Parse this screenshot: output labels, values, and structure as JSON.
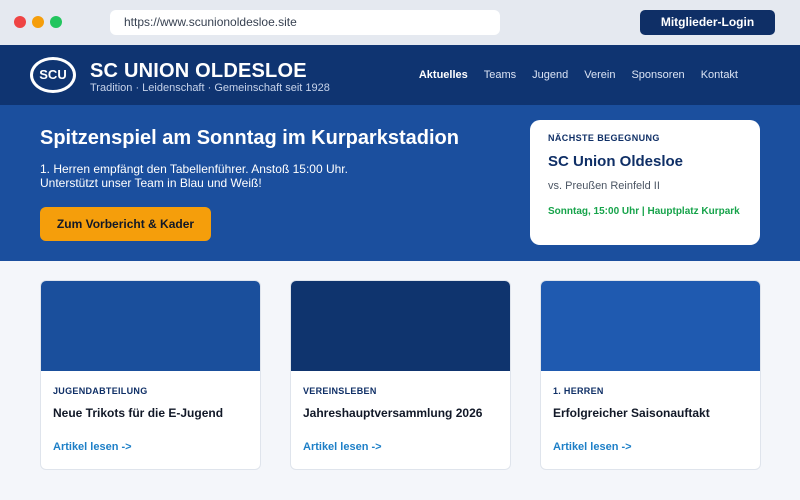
{
  "browser": {
    "url": "https://www.scunionoldesloe.site",
    "login_label": "Mitglieder-Login"
  },
  "site": {
    "logo_text": "SCU",
    "name": "SC UNION OLDESLOE",
    "tagline": "Tradition · Leidenschaft · Gemeinschaft seit 1928"
  },
  "nav": {
    "items": [
      "Aktuelles",
      "Teams",
      "Jugend",
      "Verein",
      "Sponsoren",
      "Kontakt"
    ],
    "active": "Aktuelles"
  },
  "hero": {
    "title": "Spitzenspiel am Sonntag im Kurparkstadion",
    "text_line1": "1. Herren empfängt den Tabellenführer. Anstoß 15:00 Uhr.",
    "text_line2": "Unterstützt unser Team in Blau und Weiß!",
    "button_label": "Zum Vorbericht & Kader"
  },
  "next_match": {
    "label": "NÄCHSTE BEGEGNUNG",
    "home": "SC Union Oldesloe",
    "away": "vs. Preußen Reinfeld II",
    "time": "Sonntag, 15:00 Uhr | Hauptplatz Kurpark"
  },
  "articles": [
    {
      "category": "JUGENDABTEILUNG",
      "title": "Neue Trikots für die E-Jugend",
      "link": "Artikel lesen ->",
      "color": "#1a4f9c"
    },
    {
      "category": "VEREINSLEBEN",
      "title": "Jahreshauptversammlung 2026",
      "link": "Artikel lesen ->",
      "color": "#0f346e"
    },
    {
      "category": "1. HERREN",
      "title": "Erfolgreicher Saisonauftakt",
      "link": "Artikel lesen ->",
      "color": "#1f5ab0"
    }
  ],
  "colors": {
    "brand_dark": "#0f3471",
    "brand": "#1b4f9e",
    "accent": "#f59e0b",
    "success": "#16a34a",
    "link": "#1d7fc7"
  }
}
